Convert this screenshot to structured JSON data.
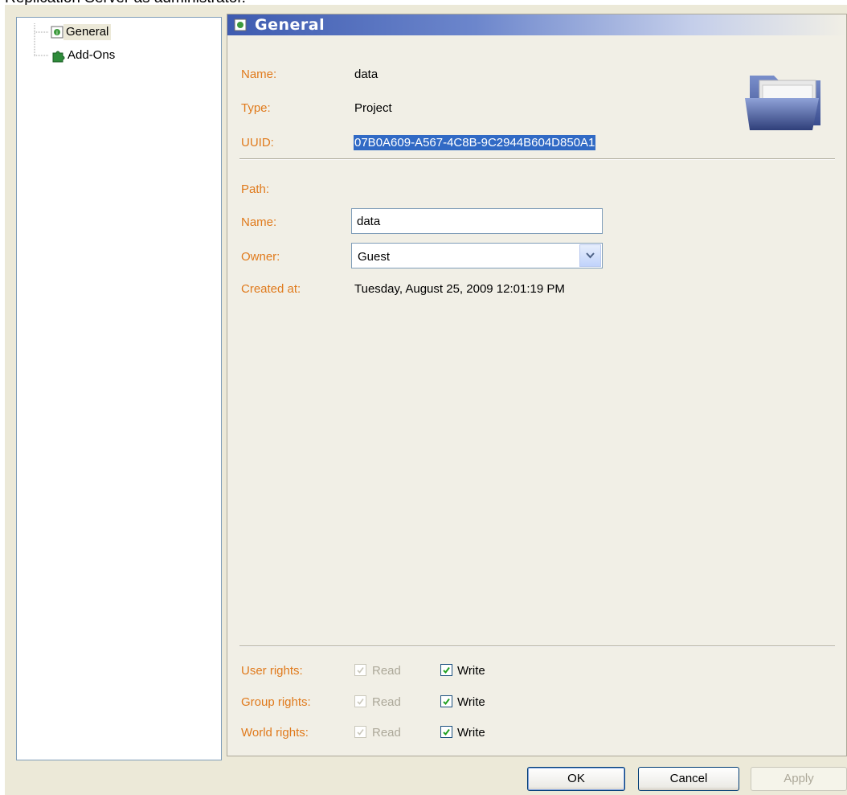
{
  "caption": "Replication Server as administrator.",
  "tree": {
    "items": [
      {
        "label": "General",
        "icon": "general-page-icon"
      },
      {
        "label": "Add-Ons",
        "icon": "puzzle-piece-icon"
      }
    ]
  },
  "panel": {
    "title": "General",
    "name_label": "Name:",
    "name_value": "data",
    "type_label": "Type:",
    "type_value": "Project",
    "uuid_label": "UUID:",
    "uuid_value": "07B0A609-A567-4C8B-9C2944B604D850A1",
    "path_label": "Path:",
    "path_name_label": "Name:",
    "path_name_value": "data",
    "owner_label": "Owner:",
    "owner_value": "Guest",
    "created_label": "Created at:",
    "created_value": "Tuesday, August 25, 2009 12:01:19 PM",
    "rights": [
      {
        "label": "User rights:",
        "read_label": "Read",
        "write_label": "Write",
        "read": true,
        "write": true
      },
      {
        "label": "Group rights:",
        "read_label": "Read",
        "write_label": "Write",
        "read": true,
        "write": true
      },
      {
        "label": "World rights:",
        "read_label": "Read",
        "write_label": "Write",
        "read": true,
        "write": true
      }
    ]
  },
  "buttons": {
    "ok": "OK",
    "cancel": "Cancel",
    "apply": "Apply"
  },
  "colors": {
    "label": "#E07A1C",
    "header": "#3E5BB0",
    "selection": "#316AC5"
  }
}
